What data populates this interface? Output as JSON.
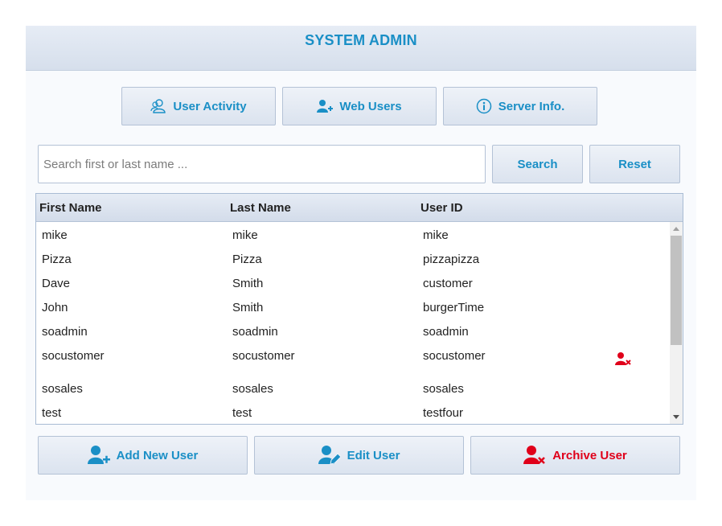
{
  "header": {
    "title": "SYSTEM ADMIN"
  },
  "nav": {
    "user_activity": "User Activity",
    "web_users": "Web Users",
    "server_info": "Server Info."
  },
  "search": {
    "placeholder": "Search first or last name ...",
    "value": "",
    "search_label": "Search",
    "reset_label": "Reset"
  },
  "table": {
    "columns": [
      "First Name",
      "Last Name",
      "User ID"
    ],
    "rows": [
      [
        "mike",
        "mike",
        "mike"
      ],
      [
        "Pizza",
        "Pizza",
        "pizzapizza"
      ],
      [
        "Dave",
        "Smith",
        "customer"
      ],
      [
        "John",
        "Smith",
        "burgerTime"
      ],
      [
        "soadmin",
        "soadmin",
        "soadmin"
      ],
      [
        "socustomer",
        "socustomer",
        "socustomer"
      ],
      [
        "sosales",
        "sosales",
        "sosales"
      ],
      [
        "test",
        "test",
        "testfour"
      ]
    ],
    "archived_row_index": 5
  },
  "actions": {
    "add_user": "Add New User",
    "edit_user": "Edit User",
    "archive_user": "Archive User"
  },
  "colors": {
    "accent": "#1a8fc6",
    "danger": "#e0001a"
  },
  "icons": {
    "user_activity": "users-outline-icon",
    "web_users": "user-add-icon",
    "server_info": "info-circle-icon",
    "add_user": "user-add-icon",
    "edit_user": "user-edit-icon",
    "archive_user": "user-remove-icon"
  }
}
